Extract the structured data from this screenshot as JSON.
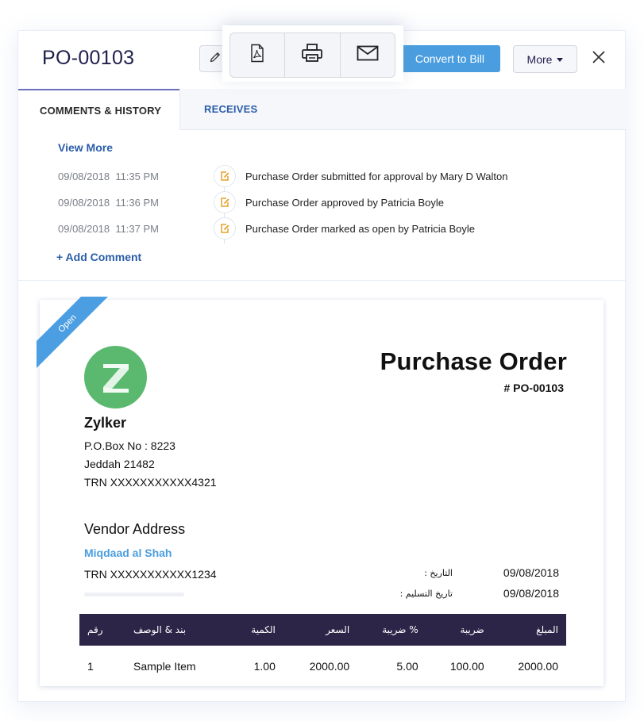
{
  "header": {
    "title": "PO-00103",
    "convert_label": "Convert to Bill",
    "more_label": "More"
  },
  "toolbar": {
    "icons": [
      "pdf-icon",
      "print-icon",
      "email-icon"
    ]
  },
  "tabs": [
    {
      "label": "COMMENTS & HISTORY",
      "active": true
    },
    {
      "label": "RECEIVES",
      "active": false
    }
  ],
  "history": {
    "view_more_label": "View More",
    "add_comment_label": "+  Add Comment",
    "entries": [
      {
        "date": "09/08/2018",
        "time": "11:35 PM",
        "text": "Purchase Order submitted for approval by Mary D Walton"
      },
      {
        "date": "09/08/2018",
        "time": "11:36 PM",
        "text": "Purchase Order approved by Patricia Boyle"
      },
      {
        "date": "09/08/2018",
        "time": "11:37 PM",
        "text": "Purchase Order marked as open by Patricia Boyle"
      }
    ]
  },
  "document": {
    "status_ribbon": "Open",
    "logo_letter": "Z",
    "title": "Purchase Order",
    "number": "# PO-00103",
    "company": {
      "name": "Zylker",
      "lines": [
        "P.O.Box No : 8223",
        "Jeddah 21482",
        "TRN XXXXXXXXXXX4321"
      ]
    },
    "vendor": {
      "heading": "Vendor Address",
      "name": "Miqdaad al Shah",
      "trn": "TRN XXXXXXXXXXX1234"
    },
    "meta": [
      {
        "label": "التاريخ :",
        "value": "09/08/2018"
      },
      {
        "label": "تاريخ التسليم :",
        "value": "09/08/2018"
      }
    ],
    "table": {
      "headers": [
        "رقم",
        "بند & الوصف",
        "الكمية",
        "السعر",
        "ضريبة %",
        "ضريبة",
        "المبلغ"
      ],
      "rows": [
        [
          "1",
          "Sample Item",
          "1.00",
          "2000.00",
          "5.00",
          "100.00",
          "2000.00"
        ]
      ]
    }
  },
  "colors": {
    "accent": "#4a9ee0",
    "link": "#2a5da8",
    "title": "#21214f",
    "table_header": "#2d2548",
    "logo": "#5bb96f",
    "history_icon": "#e8a02a"
  }
}
